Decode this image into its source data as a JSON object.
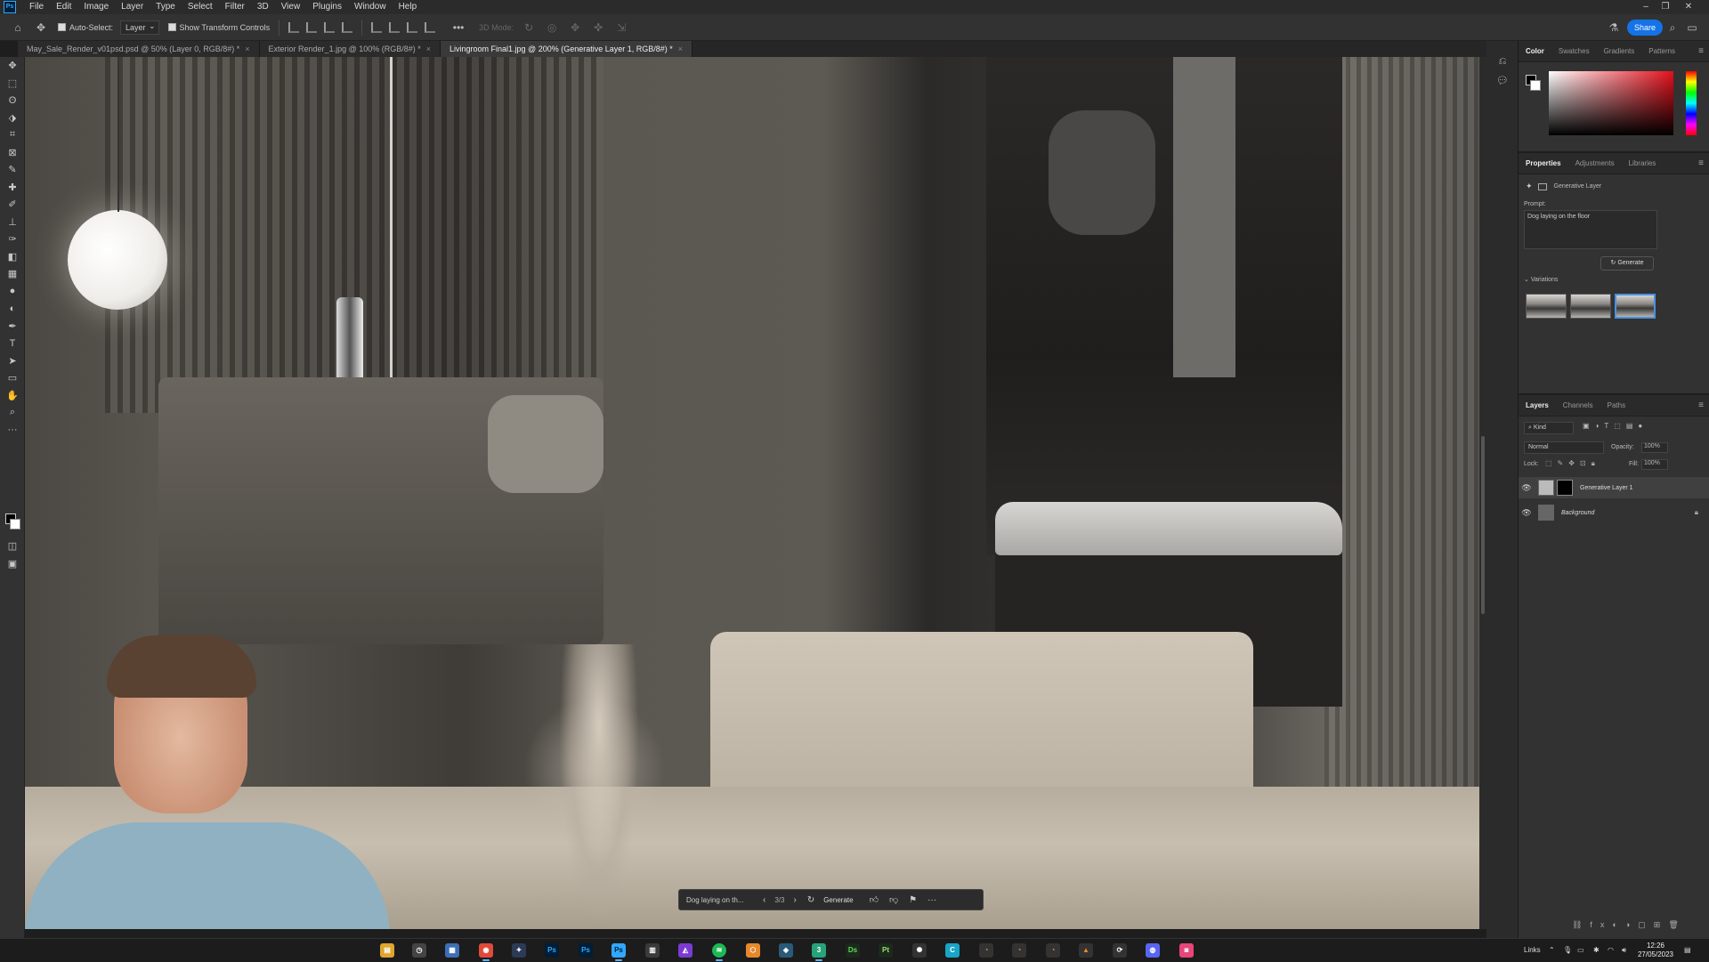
{
  "menubar": {
    "items": [
      "File",
      "Edit",
      "Image",
      "Layer",
      "Type",
      "Select",
      "Filter",
      "3D",
      "View",
      "Plugins",
      "Window",
      "Help"
    ]
  },
  "options_bar": {
    "auto_select_label": "Auto-Select:",
    "auto_select_target": "Layer",
    "show_transform_label": "Show Transform Controls",
    "mode_label": "3D Mode:",
    "share_label": "Share"
  },
  "doc_tabs": [
    {
      "label": "May_Sale_Render_v01psd.psd @ 50% (Layer 0, RGB/8#) *",
      "active": false
    },
    {
      "label": "Exterior Render_1.jpg @ 100% (RGB/8#) *",
      "active": false
    },
    {
      "label": "Livingroom Final1.jpg @ 200% (Generative Layer 1, RGB/8#) *",
      "active": true
    }
  ],
  "tools": [
    "move-tool",
    "marquee-tool",
    "lasso-tool",
    "object-select-tool",
    "crop-tool",
    "frame-tool",
    "eyedropper-tool",
    "healing-brush-tool",
    "brush-tool",
    "clone-stamp-tool",
    "history-brush-tool",
    "eraser-tool",
    "gradient-tool",
    "blur-tool",
    "dodge-tool",
    "pen-tool",
    "type-tool",
    "path-select-tool",
    "rectangle-tool",
    "hand-tool",
    "zoom-tool",
    "more-tools"
  ],
  "contextual_bar": {
    "prompt_text": "Dog laying on th...",
    "counter": "3/3",
    "generate_label": "Generate"
  },
  "color_panel": {
    "tabs": [
      "Color",
      "Swatches",
      "Gradients",
      "Patterns"
    ],
    "active_tab": "Color",
    "hue_color": "#e5101c"
  },
  "properties_panel": {
    "tabs": [
      "Properties",
      "Adjustments",
      "Libraries"
    ],
    "active_tab": "Properties",
    "layer_type": "Generative Layer",
    "prompt_label": "Prompt:",
    "prompt_value": "Dog laying on the floor",
    "generate_label": "Generate",
    "variations_label": "Variations",
    "variation_count": 3,
    "selected_variation": 3
  },
  "layers_panel": {
    "tabs": [
      "Layers",
      "Channels",
      "Paths"
    ],
    "active_tab": "Layers",
    "filter_label": "Kind",
    "blend_mode": "Normal",
    "opacity_label": "Opacity:",
    "opacity_value": "100%",
    "lock_label": "Lock:",
    "fill_label": "Fill:",
    "fill_value": "100%",
    "layers": [
      {
        "name": "Generative Layer 1",
        "visible": true,
        "active": true
      },
      {
        "name": "Background",
        "visible": true,
        "locked": true
      }
    ]
  },
  "taskbar": {
    "apps": [
      "file-explorer",
      "clock-app",
      "calculator",
      "chrome",
      "vector-app",
      "photoshop-a",
      "photoshop-b",
      "photoshop-active",
      "notes",
      "affinity",
      "spotify",
      "blender-like",
      "sketchup",
      "app-3",
      "dimension",
      "prelude",
      "settings",
      "cinema",
      "blender-a",
      "blender-b",
      "blender-c",
      "vlc",
      "sync",
      "discord",
      "camera-app"
    ],
    "tray_label": "Links",
    "time": "12:26",
    "date": "27/05/2023"
  }
}
